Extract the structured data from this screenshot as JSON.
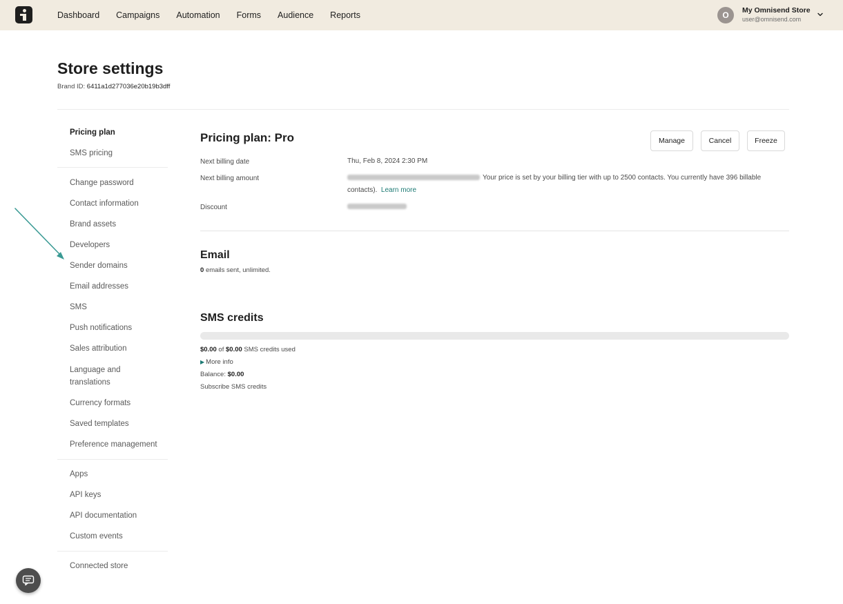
{
  "nav": {
    "items": [
      "Dashboard",
      "Campaigns",
      "Automation",
      "Forms",
      "Audience",
      "Reports"
    ]
  },
  "account": {
    "initial": "O",
    "store_name": "My Omnisend Store",
    "email": "user@omnisend.com"
  },
  "page": {
    "title": "Store settings",
    "brand_id_label": "Brand ID:",
    "brand_id_value": "6411a1d277036e20b19b3dff"
  },
  "sidebar": {
    "groups": [
      [
        "Pricing plan",
        "SMS pricing"
      ],
      [
        "Change password",
        "Contact information",
        "Brand assets",
        "Developers",
        "Sender domains",
        "Email addresses",
        "SMS",
        "Push notifications",
        "Sales attribution",
        "Language and translations",
        "Currency formats",
        "Saved templates",
        "Preference management"
      ],
      [
        "Apps",
        "API keys",
        "API documentation",
        "Custom events"
      ],
      [
        "Connected store"
      ]
    ],
    "active": "Pricing plan"
  },
  "plan": {
    "title": "Pricing plan: Pro",
    "buttons": {
      "manage": "Manage",
      "cancel": "Cancel",
      "freeze": "Freeze"
    },
    "next_billing_date_label": "Next billing date",
    "next_billing_date_value": "Thu, Feb 8, 2024 2:30 PM",
    "next_billing_amount_label": "Next billing amount",
    "next_billing_amount_text": "Your price is set by your billing tier with up to 2500 contacts. You currently have 396 billable",
    "next_billing_amount_text2": "contacts).",
    "learn_more": "Learn more",
    "discount_label": "Discount"
  },
  "email": {
    "title": "Email",
    "count": "0",
    "suffix": "emails sent, unlimited."
  },
  "sms": {
    "title": "SMS credits",
    "used_amount": "$0.00",
    "used_of": "of",
    "total_amount": "$0.00",
    "used_suffix": "SMS credits used",
    "usage_fraction": 0,
    "more_info": "More info",
    "balance_label": "Balance:",
    "balance_value": "$0.00",
    "subscribe_link": "Subscribe SMS credits"
  },
  "colors": {
    "topbar": "#f1ebe0",
    "accent": "#1d7a74",
    "annotation_arrow": "#3a9a94"
  },
  "icons": {
    "logo": "omnisend-logo",
    "chevron": "chevron-down-icon",
    "chat": "chat-icon",
    "annotation": "arrow-annotation"
  }
}
